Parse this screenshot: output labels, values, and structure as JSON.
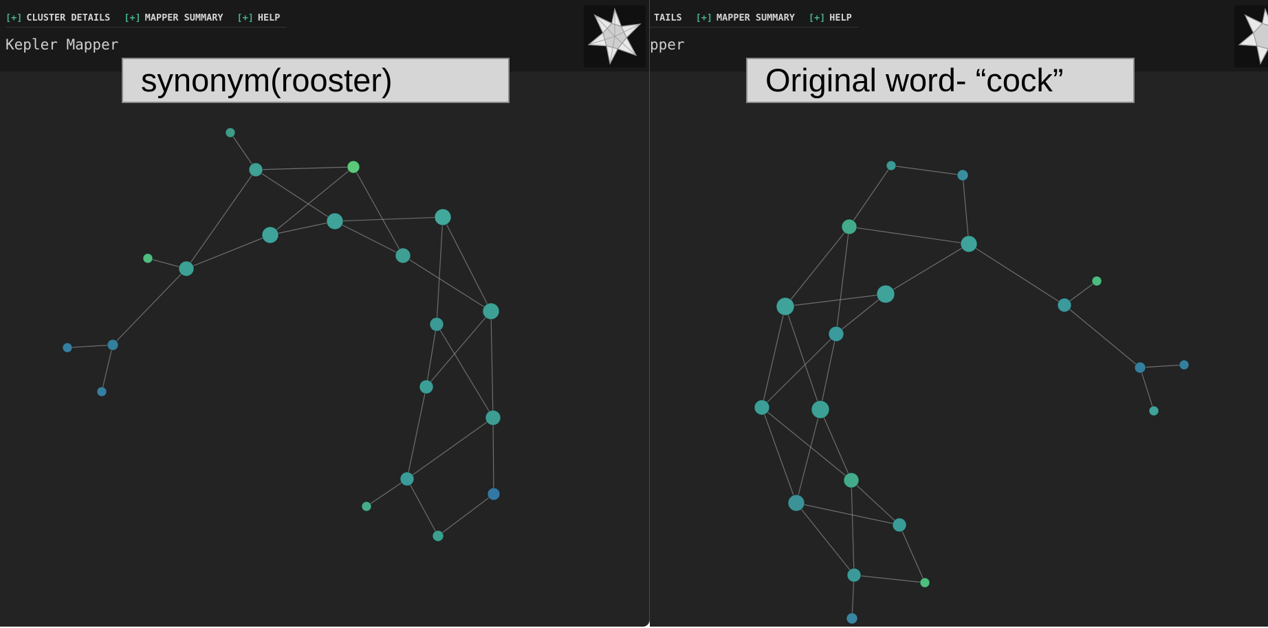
{
  "panels": [
    {
      "menu": [
        {
          "bracket": "[+]",
          "label": "CLUSTER DETAILS"
        },
        {
          "bracket": "[+]",
          "label": "MAPPER SUMMARY"
        },
        {
          "bracket": "[+]",
          "label": "HELP"
        }
      ],
      "app_title": "Kepler Mapper",
      "caption": "synonym(rooster)",
      "graph_nodes": [
        {
          "id": "n1",
          "color": "#3e9b86"
        },
        {
          "id": "n2",
          "color": "#3fa093"
        },
        {
          "id": "n3",
          "color": "#5ac97a"
        },
        {
          "id": "n4",
          "color": "#3fa39a"
        },
        {
          "id": "n5",
          "color": "#3fa39a"
        },
        {
          "id": "n6",
          "color": "#43a89c"
        },
        {
          "id": "n7",
          "color": "#4fbc82"
        },
        {
          "id": "n8",
          "color": "#3da094"
        },
        {
          "id": "n9",
          "color": "#3f9f95"
        },
        {
          "id": "n10",
          "color": "#3da094"
        },
        {
          "id": "n11",
          "color": "#3b9a96"
        },
        {
          "id": "n12",
          "color": "#347f9a"
        },
        {
          "id": "n13",
          "color": "#357fa0"
        },
        {
          "id": "n14",
          "color": "#357fa0"
        },
        {
          "id": "n15",
          "color": "#3b9f98"
        },
        {
          "id": "n16",
          "color": "#3d9d93"
        },
        {
          "id": "n17",
          "color": "#3a9c99"
        },
        {
          "id": "n18",
          "color": "#45ad8a"
        },
        {
          "id": "n19",
          "color": "#3ba090"
        },
        {
          "id": "n20",
          "color": "#3378a2"
        },
        {
          "id": "n21",
          "color": "#3a7fa0"
        }
      ]
    },
    {
      "menu": [
        {
          "bracket": "",
          "label": "TAILS"
        },
        {
          "bracket": "[+]",
          "label": "MAPPER SUMMARY"
        },
        {
          "bracket": "[+]",
          "label": "HELP"
        }
      ],
      "app_title": "pper",
      "caption": "Original word- “cock”",
      "graph_nodes": [
        {
          "id": "m1",
          "color": "#3c9a95"
        },
        {
          "id": "m2",
          "color": "#3a8ea0"
        },
        {
          "id": "m3",
          "color": "#43aa8b"
        },
        {
          "id": "m4",
          "color": "#3ea39a"
        },
        {
          "id": "m5",
          "color": "#3fa39a"
        },
        {
          "id": "m6",
          "color": "#3fa39a"
        },
        {
          "id": "m7",
          "color": "#3a9a9c"
        },
        {
          "id": "m8",
          "color": "#4cbc80"
        },
        {
          "id": "m9",
          "color": "#3a9a9c"
        },
        {
          "id": "m10",
          "color": "#3b9f98"
        },
        {
          "id": "m11",
          "color": "#3da094"
        },
        {
          "id": "m12",
          "color": "#357f9e"
        },
        {
          "id": "m13",
          "color": "#357f9e"
        },
        {
          "id": "m14",
          "color": "#3fa39a"
        },
        {
          "id": "m15",
          "color": "#43ab8b"
        },
        {
          "id": "m16",
          "color": "#3b9397"
        },
        {
          "id": "m17",
          "color": "#3a9c98"
        },
        {
          "id": "m18",
          "color": "#3b9a98"
        },
        {
          "id": "m19",
          "color": "#4dbf7f"
        },
        {
          "id": "m20",
          "color": "#3a85a0"
        }
      ]
    }
  ],
  "colors": {
    "panel_bg": "#232323",
    "topbar_bg": "#191919",
    "menu_accent": "#43b08c",
    "edge": "#8a8a8a",
    "caption_bg": "#d6d6d6"
  },
  "icons": {
    "logo": "stellated-polyhedron-icon"
  }
}
